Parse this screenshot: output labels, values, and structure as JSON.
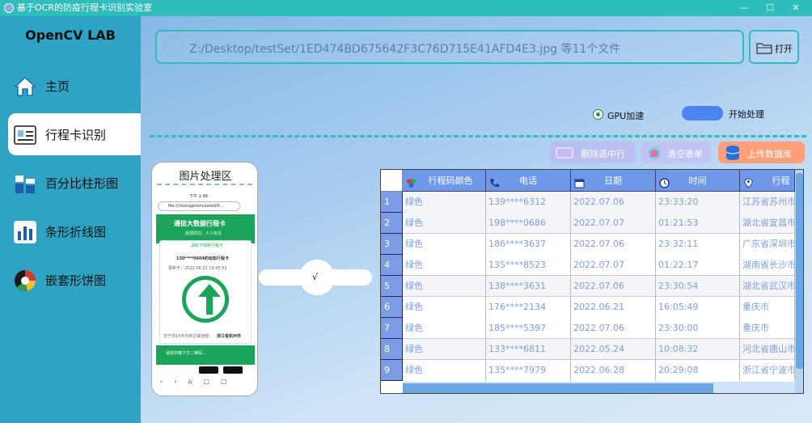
{
  "window": {
    "title": "基于OCR的防疫行程卡识别实验室",
    "controls": [
      "—",
      "☐",
      "✕"
    ]
  },
  "sidebar": {
    "brand": "OpenCV LAB",
    "items": [
      {
        "label": "主页",
        "icon": "home-icon",
        "active": false
      },
      {
        "label": "行程卡识别",
        "icon": "id-card-icon",
        "active": true
      },
      {
        "label": "百分比柱形图",
        "icon": "bar-chart-icon",
        "active": false
      },
      {
        "label": "条形折线图",
        "icon": "column-chart-icon",
        "active": false
      },
      {
        "label": "嵌套形饼图",
        "icon": "pie-chart-icon",
        "active": false
      }
    ]
  },
  "toolbar": {
    "path": "Z:/Desktop/testSet/1ED474BD675642F3C76D715E41AFD4E3.jpg 等11个文件",
    "open_label": "打开",
    "gpu_label": "GPU加速",
    "gpu_checked": true,
    "start_label": "开始处理"
  },
  "actions": {
    "delete_label": "删除选中行",
    "clear_label": "清空表单",
    "upload_label": "上传数据库"
  },
  "preview": {
    "title": "图片处理区",
    "phone": {
      "status": "下午 1:49",
      "url": "file:///storage/emulated/0...",
      "banner": "通信大数据行程卡",
      "slogan": "疫情防控，人人有责",
      "tip": "请收下绿色行程卡",
      "phone_line": "130****0604的动态行程卡",
      "update_time": "更新于：2022.06.22 19:45:52",
      "visited_prefix": "您于前14天内到达或途经：",
      "visited": "浙江省杭州市",
      "footer": "请您扫描下方二维码..."
    },
    "flow_mark": "√"
  },
  "table": {
    "columns": [
      {
        "label": "行程码颜色",
        "icon": "palette-icon"
      },
      {
        "label": "电话",
        "icon": "phone-icon"
      },
      {
        "label": "日期",
        "icon": "calendar-icon"
      },
      {
        "label": "时间",
        "icon": "clock-icon"
      },
      {
        "label": "行程",
        "icon": "location-icon"
      }
    ],
    "rows": [
      {
        "n": "1",
        "color": "绿色",
        "phone": "139****6312",
        "date": "2022.07.06",
        "time": "23:33:20",
        "route": "江苏省苏州市"
      },
      {
        "n": "2",
        "color": "绿色",
        "phone": "198****0686",
        "date": "2022.07.07",
        "time": "01:21:53",
        "route": "湖北省宜昌市"
      },
      {
        "n": "3",
        "color": "绿色",
        "phone": "186****3637",
        "date": "2022.07.06",
        "time": "23:32:11",
        "route": "广东省深圳市"
      },
      {
        "n": "4",
        "color": "绿色",
        "phone": "135****8523",
        "date": "2022.07.07",
        "time": "01:22:17",
        "route": "湖南省长沙市"
      },
      {
        "n": "5",
        "color": "绿色",
        "phone": "138****3631",
        "date": "2022.07.06",
        "time": "23:30:54",
        "route": "湖北省武汉市"
      },
      {
        "n": "6",
        "color": "绿色",
        "phone": "176****2134",
        "date": "2022.06.21",
        "time": "16:05:49",
        "route": "重庆市"
      },
      {
        "n": "7",
        "color": "绿色",
        "phone": "185****5397",
        "date": "2022.07.06",
        "time": "23:30:00",
        "route": "重庆市"
      },
      {
        "n": "8",
        "color": "绿色",
        "phone": "133****6811",
        "date": "2022.05.24",
        "time": "10:08:32",
        "route": "河北省唐山市"
      },
      {
        "n": "9",
        "color": "绿色",
        "phone": "135****7979",
        "date": "2022.06.28",
        "time": "20:29:08",
        "route": "浙江省宁波市"
      }
    ]
  },
  "colors": {
    "accent": "#2ebdb9",
    "sidebar": "#2ea3c4",
    "header": "#6e99ea",
    "green": "#1ca45a",
    "upload": "#ffa07a"
  }
}
